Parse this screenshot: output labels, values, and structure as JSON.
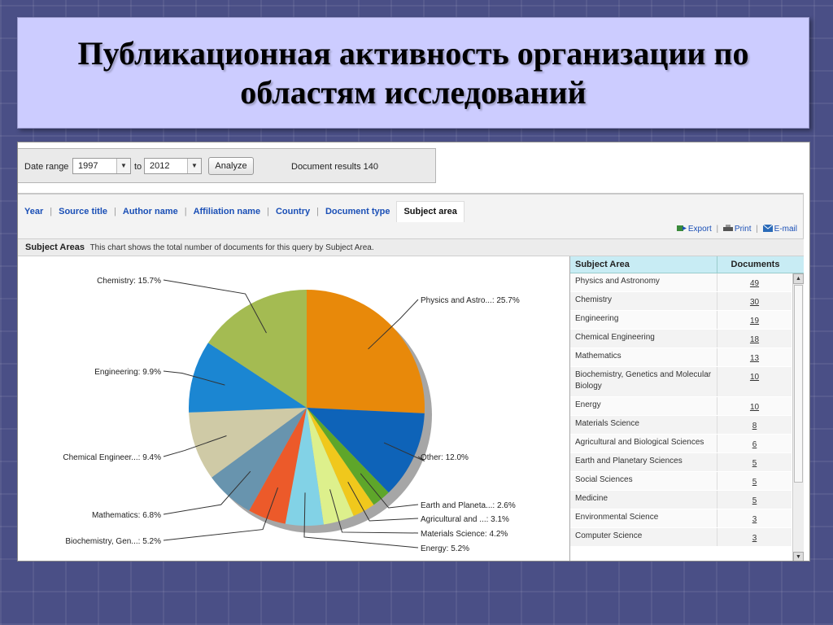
{
  "slide": {
    "title": "Публикационная активность организации по областям исследований"
  },
  "controls": {
    "date_range_label": "Date range",
    "from_year": "1997",
    "to_label": "to",
    "to_year": "2012",
    "analyze_label": "Analyze",
    "document_results": "Document results 140"
  },
  "tabs": [
    {
      "label": "Year",
      "active": false
    },
    {
      "label": "Source title",
      "active": false
    },
    {
      "label": "Author name",
      "active": false
    },
    {
      "label": "Affiliation name",
      "active": false
    },
    {
      "label": "Country",
      "active": false
    },
    {
      "label": "Document type",
      "active": false
    },
    {
      "label": "Subject area",
      "active": true
    }
  ],
  "actions": {
    "export": "Export",
    "print": "Print",
    "email": "E-mail"
  },
  "subject_areas": {
    "heading": "Subject Areas",
    "description": "This chart shows the total number of documents for this query by Subject Area."
  },
  "chart_data": {
    "type": "pie",
    "slices": [
      {
        "label": "Physics and Astro...: 25.7%",
        "value": 25.7,
        "color": "#e8890a"
      },
      {
        "label": "Other: 12.0%",
        "value": 12.0,
        "color": "#0e63b8"
      },
      {
        "label": "Earth and Planeta...: 2.6%",
        "value": 2.6,
        "color": "#5ea62a"
      },
      {
        "label": "Agricultural and ...: 3.1%",
        "value": 3.1,
        "color": "#f0c81c"
      },
      {
        "label": "Materials Science: 4.2%",
        "value": 4.2,
        "color": "#ddf08c"
      },
      {
        "label": "Energy: 5.2%",
        "value": 5.2,
        "color": "#82d2e6"
      },
      {
        "label": "Biochemistry, Gen...: 5.2%",
        "value": 5.2,
        "color": "#ec5a2a"
      },
      {
        "label": "Mathematics: 6.8%",
        "value": 6.8,
        "color": "#6894ae"
      },
      {
        "label": "Chemical Engineer...: 9.4%",
        "value": 9.4,
        "color": "#cfcaa6"
      },
      {
        "label": "Engineering: 9.9%",
        "value": 9.9,
        "color": "#1b86d2"
      },
      {
        "label": "Chemistry: 15.7%",
        "value": 15.7,
        "color": "#a4bb52"
      }
    ]
  },
  "table": {
    "headers": [
      "Subject Area",
      "Documents"
    ],
    "rows": [
      {
        "area": "Physics and Astronomy",
        "docs": "49"
      },
      {
        "area": "Chemistry",
        "docs": "30"
      },
      {
        "area": "Engineering",
        "docs": "19"
      },
      {
        "area": "Chemical Engineering",
        "docs": "18"
      },
      {
        "area": "Mathematics",
        "docs": "13"
      },
      {
        "area": "Biochemistry, Genetics and Molecular Biology",
        "docs": "10"
      },
      {
        "area": "Energy",
        "docs": "10"
      },
      {
        "area": "Materials Science",
        "docs": "8"
      },
      {
        "area": "Agricultural and Biological Sciences",
        "docs": "6"
      },
      {
        "area": "Earth and Planetary Sciences",
        "docs": "5"
      },
      {
        "area": "Social Sciences",
        "docs": "5"
      },
      {
        "area": "Medicine",
        "docs": "5"
      },
      {
        "area": "Environmental Science",
        "docs": "3"
      },
      {
        "area": "Computer Science",
        "docs": "3"
      }
    ]
  }
}
